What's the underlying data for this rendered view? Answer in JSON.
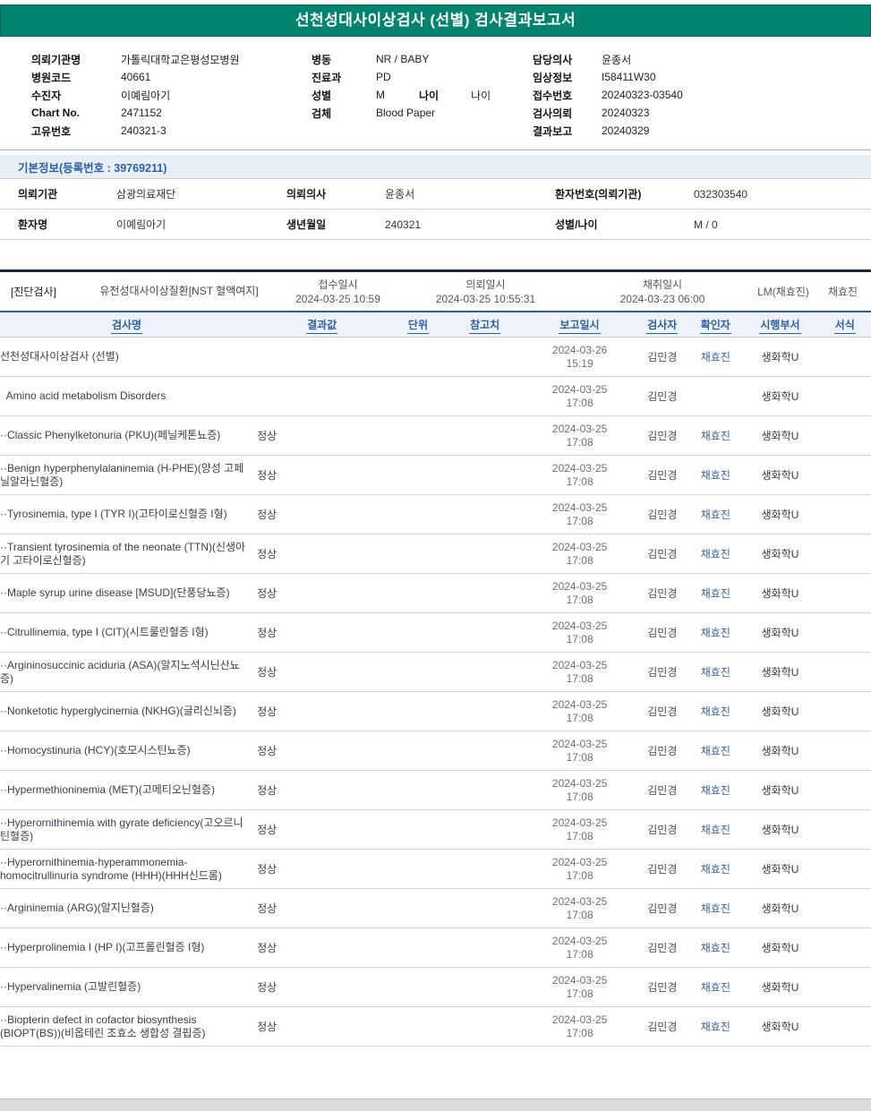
{
  "colors": {
    "teal": "#00846F",
    "accent_blue": "#2B5FA9"
  },
  "title": "선천성대사이상검사 (선별) 검사결과보고서",
  "header": {
    "left": [
      {
        "label": "의뢰기관명",
        "value": "가톨릭대학교은평성모병원"
      },
      {
        "label": "병원코드",
        "value": "40661"
      },
      {
        "label": "수진자",
        "value": "이예림아기"
      },
      {
        "label": "Chart No.",
        "value": "2471152"
      },
      {
        "label": "고유번호",
        "value": "240321-3"
      }
    ],
    "middle": [
      {
        "label": "병동",
        "value": "NR / BABY"
      },
      {
        "label": "진료과",
        "value": "PD"
      },
      {
        "label": "성별",
        "value": "M",
        "extra_label": "나이",
        "extra_value": "나이"
      },
      {
        "label": "검체",
        "value": "Blood Paper"
      }
    ],
    "right": [
      {
        "label": "담당의사",
        "value": "윤종서"
      },
      {
        "label": "임상정보",
        "value": "I58411W30"
      },
      {
        "label": "접수번호",
        "value": "20240323-03540"
      },
      {
        "label": "검사의뢰",
        "value": "20240323"
      },
      {
        "label": "결과보고",
        "value": "20240329"
      }
    ]
  },
  "basic_info": {
    "title": "기본정보(등록번호 : 39769211)",
    "rows": [
      [
        {
          "label": "의뢰기관",
          "value": "삼광의료재단"
        },
        {
          "label": "의뢰의사",
          "value": "윤종서"
        },
        {
          "label": "환자번호(의뢰기관)",
          "value": "032303540"
        }
      ],
      [
        {
          "label": "환자명",
          "value": "이예림아기"
        },
        {
          "label": "생년월일",
          "value": "240321"
        },
        {
          "label": "성별/나이",
          "value": "M / 0"
        }
      ]
    ]
  },
  "diagnosis": {
    "section_label": "[진단검사]",
    "test_group": "유전성대사이상질환[NST 혈액여지]",
    "times": [
      {
        "label": "접수일시",
        "value": "2024-03-25 10:59"
      },
      {
        "label": "의뢰일시",
        "value": "2024-03-25 10:55:31"
      },
      {
        "label": "채취일시",
        "value": "2024-03-23 06:00"
      }
    ],
    "collector": "LM(채효진)",
    "collector_name": "채효진"
  },
  "results": {
    "headers": {
      "name": "검사명",
      "result": "결과값",
      "unit": "단위",
      "ref": "참고치",
      "report": "보고일시",
      "tester": "검사자",
      "checker": "확인자",
      "dept": "시행부서",
      "form": "서식"
    },
    "rows": [
      {
        "name": "선천성대사이상검사 (선별)",
        "result": "",
        "date": "2024-03-26",
        "time": "15:19",
        "tester": "김민경",
        "checker": "채효진",
        "dept": "생화학U"
      },
      {
        "name": "  Amino acid metabolism Disorders",
        "result": "",
        "date": "2024-03-25",
        "time": "17:08",
        "tester": "김민경",
        "checker": "",
        "dept": "생화학U"
      },
      {
        "name": "··Classic Phenylketonuria (PKU)(페닐케톤뇨증)",
        "result": "정상",
        "date": "2024-03-25",
        "time": "17:08",
        "tester": "김민경",
        "checker": "채효진",
        "dept": "생화학U"
      },
      {
        "name": "··Benign hyperphenylalaninemia (H-PHE)(양성 고페닐알라닌혈증)",
        "result": "정상",
        "date": "2024-03-25",
        "time": "17:08",
        "tester": "김민경",
        "checker": "채효진",
        "dept": "생화학U"
      },
      {
        "name": "··Tyrosinemia, type I (TYR I)(고타이로신혈증 I형)",
        "result": "정상",
        "date": "2024-03-25",
        "time": "17:08",
        "tester": "김민경",
        "checker": "채효진",
        "dept": "생화학U"
      },
      {
        "name": "··Transient tyrosinemia of the neonate (TTN)(신생아기 고타이로신혈증)",
        "result": "정상",
        "date": "2024-03-25",
        "time": "17:08",
        "tester": "김민경",
        "checker": "채효진",
        "dept": "생화학U"
      },
      {
        "name": "··Maple syrup urine disease [MSUD](단풍당뇨증)",
        "result": "정상",
        "date": "2024-03-25",
        "time": "17:08",
        "tester": "김민경",
        "checker": "채효진",
        "dept": "생화학U"
      },
      {
        "name": "··Citrullinemia, type I (CIT)(시트룰린혈증 I형)",
        "result": "정상",
        "date": "2024-03-25",
        "time": "17:08",
        "tester": "김민경",
        "checker": "채효진",
        "dept": "생화학U"
      },
      {
        "name": "··Argininosuccinic aciduria (ASA)(알지노석시닌산뇨증)",
        "result": "정상",
        "date": "2024-03-25",
        "time": "17:08",
        "tester": "김민경",
        "checker": "채효진",
        "dept": "생화학U"
      },
      {
        "name": "··Nonketotic hyperglycinemia (NKHG)(글리신뇌증)",
        "result": "정상",
        "date": "2024-03-25",
        "time": "17:08",
        "tester": "김민경",
        "checker": "채효진",
        "dept": "생화학U"
      },
      {
        "name": "··Homocystinuria (HCY)(호모시스틴뇨증)",
        "result": "정상",
        "date": "2024-03-25",
        "time": "17:08",
        "tester": "김민경",
        "checker": "채효진",
        "dept": "생화학U"
      },
      {
        "name": "··Hypermethioninemia (MET)(고메티오닌혈증)",
        "result": "정상",
        "date": "2024-03-25",
        "time": "17:08",
        "tester": "김민경",
        "checker": "채효진",
        "dept": "생화학U"
      },
      {
        "name": "··Hyperornithinemia with gyrate deficiency(고오르니틴혈증)",
        "result": "정상",
        "date": "2024-03-25",
        "time": "17:08",
        "tester": "김민경",
        "checker": "채효진",
        "dept": "생화학U"
      },
      {
        "name": "··Hyperornithinemia-hyperammonemia-homocitrullinuria syndrome (HHH)(HHH신드롬)",
        "result": "정상",
        "date": "2024-03-25",
        "time": "17:08",
        "tester": "김민경",
        "checker": "채효진",
        "dept": "생화학U"
      },
      {
        "name": "··Argininemia (ARG)(알지닌혈증)",
        "result": "정상",
        "date": "2024-03-25",
        "time": "17:08",
        "tester": "김민경",
        "checker": "채효진",
        "dept": "생화학U"
      },
      {
        "name": "··Hyperprolinemia I (HP I)(고프롤린혈증 I형)",
        "result": "정상",
        "date": "2024-03-25",
        "time": "17:08",
        "tester": "김민경",
        "checker": "채효진",
        "dept": "생화학U"
      },
      {
        "name": "··Hypervalinemia (고발린혈증)",
        "result": "정상",
        "date": "2024-03-25",
        "time": "17:08",
        "tester": "김민경",
        "checker": "채효진",
        "dept": "생화학U"
      },
      {
        "name": "··Biopterin defect in cofactor biosynthesis (BIOPT(BS))(비옵테린 조효소 생합성 결핍증)",
        "result": "정상",
        "date": "2024-03-25",
        "time": "17:08",
        "tester": "김민경",
        "checker": "채효진",
        "dept": "생화학U"
      }
    ]
  }
}
